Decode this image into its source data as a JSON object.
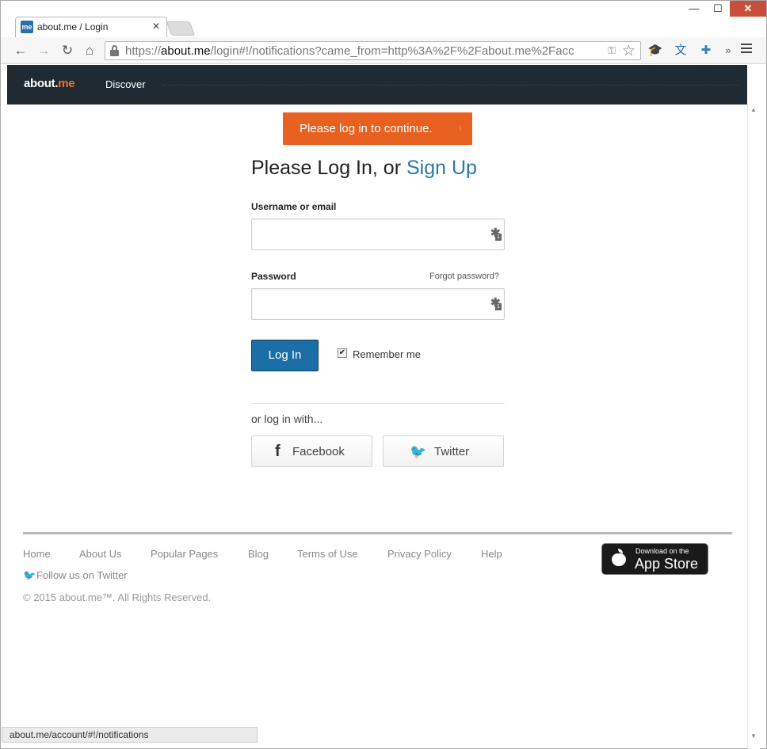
{
  "browser": {
    "tab_title": "about.me / Login",
    "favicon_text": "me",
    "url_scheme": "https://",
    "url_host": "about.me",
    "url_path": "/login#!/notifications?came_from=http%3A%2F%2Fabout.me%2Facc",
    "status_url": "about.me/account/#!/notifications"
  },
  "site_header": {
    "logo_main": "about.",
    "logo_accent": "me",
    "nav_discover": "Discover"
  },
  "login": {
    "alert": "Please log in to continue.",
    "alert_dismiss": "\\",
    "heading_prefix": "Please Log In, or ",
    "heading_signup": "Sign Up",
    "username_label": "Username or email",
    "username_value": "",
    "password_label": "Password",
    "password_value": "",
    "forgot_password": "Forgot password?",
    "login_button": "Log In",
    "remember_me": "Remember me",
    "remember_checked": true,
    "or_log_in_with": "or log in with...",
    "facebook": "Facebook",
    "twitter": "Twitter"
  },
  "footer": {
    "links": [
      "Home",
      "About Us",
      "Popular Pages",
      "Blog",
      "Terms of Use",
      "Privacy Policy",
      "Help"
    ],
    "follow": "Follow us on Twitter",
    "copyright": "© 2015 about.me™. All Rights Reserved.",
    "appstore_small": "Download on the",
    "appstore_big": "App Store"
  },
  "colors": {
    "header_bg": "#1f2a32",
    "alert_bg": "#e8601f",
    "primary_button": "#1c6ea6",
    "signup_link": "#2a78a8"
  }
}
